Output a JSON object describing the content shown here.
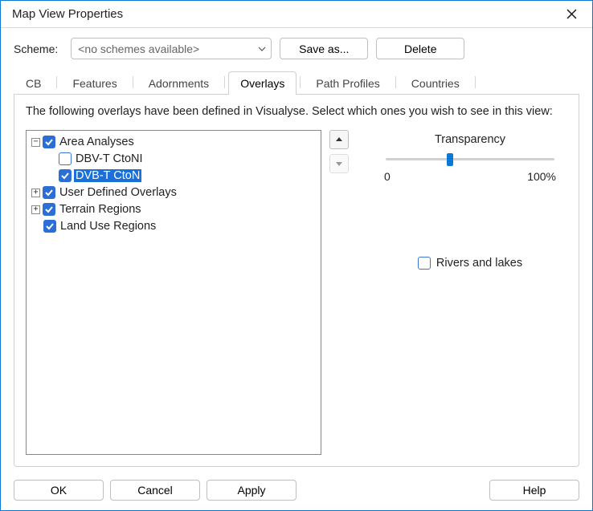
{
  "window": {
    "title": "Map View Properties"
  },
  "scheme": {
    "label": "Scheme:",
    "placeholder": "<no schemes available>",
    "save_as": "Save as...",
    "delete": "Delete"
  },
  "tabs": {
    "cb": "CB",
    "features": "Features",
    "adornments": "Adornments",
    "overlays": "Overlays",
    "path_profiles": "Path Profiles",
    "countries": "Countries",
    "active": "overlays"
  },
  "overlays": {
    "instruction": "The following overlays have been defined in Visualyse. Select which ones you wish to see in this view:",
    "tree": {
      "area_analyses": {
        "label": "Area Analyses",
        "checked": true,
        "expanded": true
      },
      "dbv_t_ctoni": {
        "label": "DBV-T CtoNI",
        "checked": false
      },
      "dvb_t_cton": {
        "label": "DVB-T CtoN",
        "checked": true,
        "selected": true
      },
      "user_defined": {
        "label": "User Defined Overlays",
        "checked": true,
        "expanded": false
      },
      "terrain": {
        "label": "Terrain Regions",
        "checked": true,
        "expanded": false
      },
      "landuse": {
        "label": "Land Use Regions",
        "checked": true
      }
    },
    "transparency": {
      "title": "Transparency",
      "min_label": "0",
      "max_label": "100%",
      "value_pct": 38
    },
    "rivers": {
      "label": "Rivers and lakes",
      "checked": false
    }
  },
  "footer": {
    "ok": "OK",
    "cancel": "Cancel",
    "apply": "Apply",
    "help": "Help"
  }
}
